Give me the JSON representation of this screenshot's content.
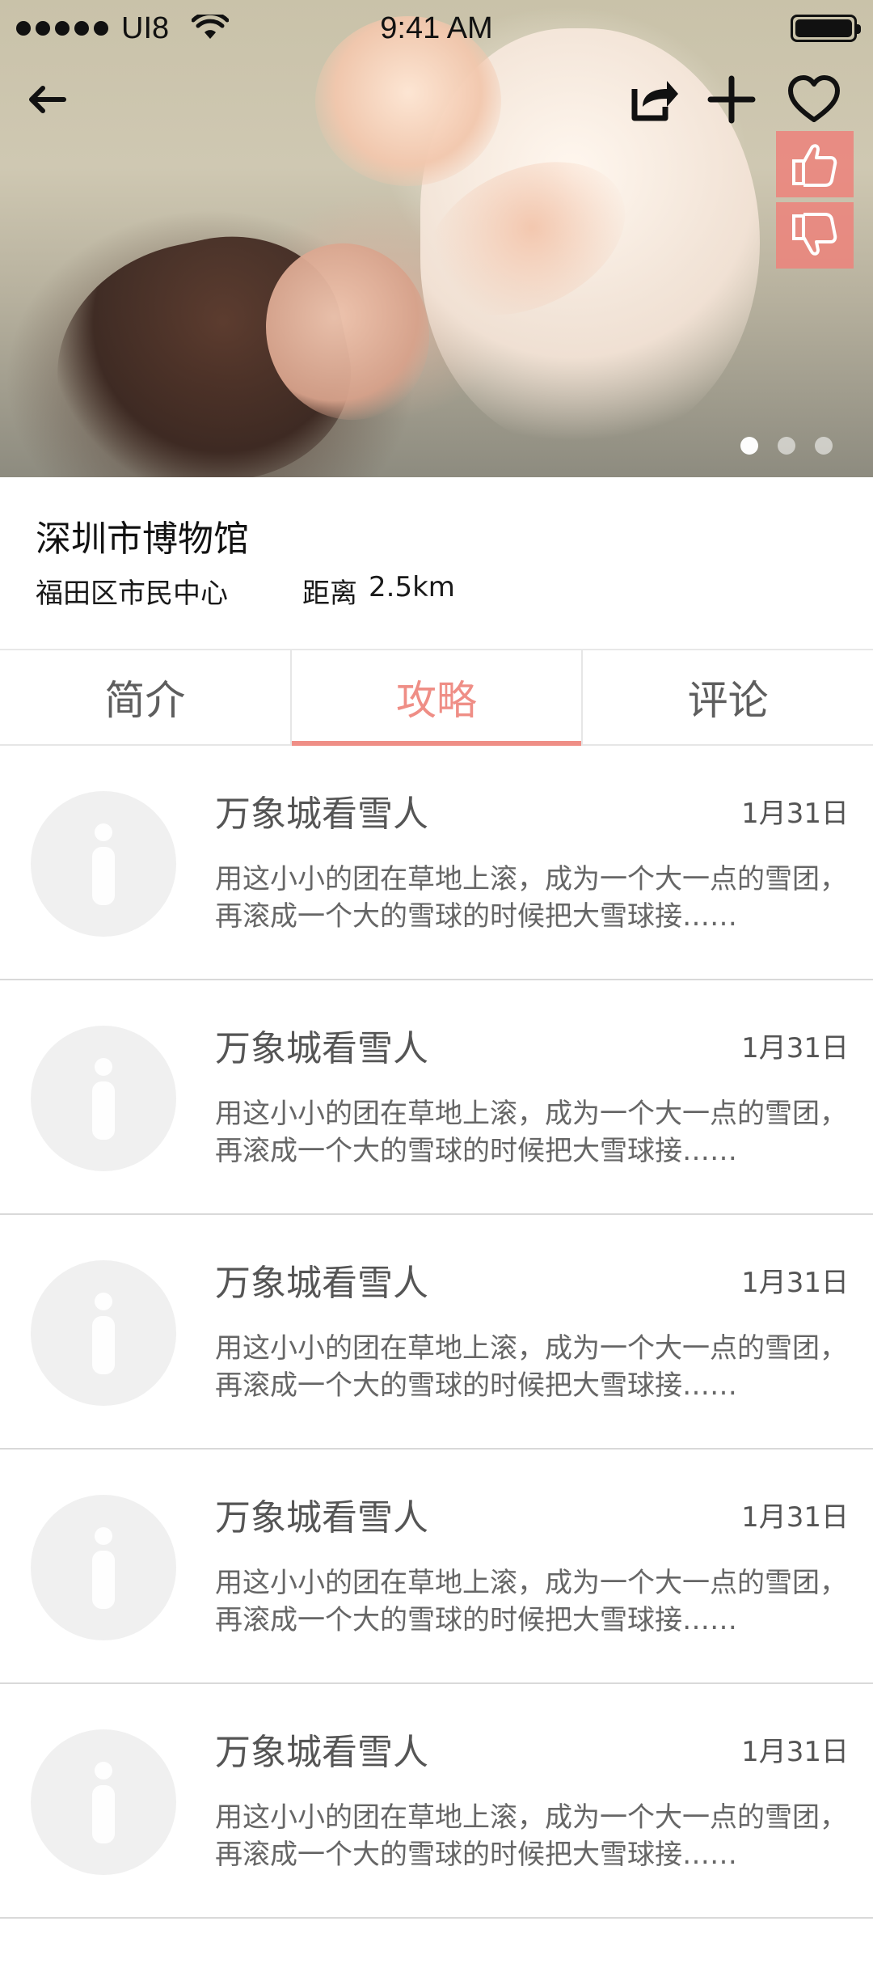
{
  "status_bar": {
    "carrier": "UI8",
    "time": "9:41 AM"
  },
  "hero": {
    "icons": {
      "back": "arrow-left-icon",
      "share": "share-icon",
      "add": "plus-icon",
      "favorite": "heart-outline-icon",
      "like": "thumbs-up-icon",
      "dislike": "thumbs-down-icon"
    },
    "pager": {
      "count": 3,
      "active_index": 0
    }
  },
  "place": {
    "name": "深圳市博物馆",
    "area": "福田区市民中心",
    "distance_label": "距离",
    "distance_value": "2.5km"
  },
  "tabs": [
    {
      "label": "简介",
      "active": false
    },
    {
      "label": "攻略",
      "active": true
    },
    {
      "label": "评论",
      "active": false
    }
  ],
  "list": {
    "items": [
      {
        "title": "万象城看雪人",
        "date": "1月31日",
        "desc": "用这小小的团在草地上滚，成为一个大一点的雪团，再滚成一个大的雪球的时候把大雪球接……"
      },
      {
        "title": "万象城看雪人",
        "date": "1月31日",
        "desc": "用这小小的团在草地上滚，成为一个大一点的雪团，再滚成一个大的雪球的时候把大雪球接……"
      },
      {
        "title": "万象城看雪人",
        "date": "1月31日",
        "desc": "用这小小的团在草地上滚，成为一个大一点的雪团，再滚成一个大的雪球的时候把大雪球接……"
      },
      {
        "title": "万象城看雪人",
        "date": "1月31日",
        "desc": "用这小小的团在草地上滚，成为一个大一点的雪团，再滚成一个大的雪球的时候把大雪球接……"
      },
      {
        "title": "万象城看雪人",
        "date": "1月31日",
        "desc": "用这小小的团在草地上滚，成为一个大一点的雪团，再滚成一个大的雪球的时候把大雪球接……"
      }
    ]
  },
  "colors": {
    "accent": "#ef8e86",
    "vote_bg": "#ec847c",
    "text_primary": "#121212",
    "text_secondary": "#555555",
    "divider": "#d9d9d9",
    "avatar_bg": "#f0f0f0"
  }
}
